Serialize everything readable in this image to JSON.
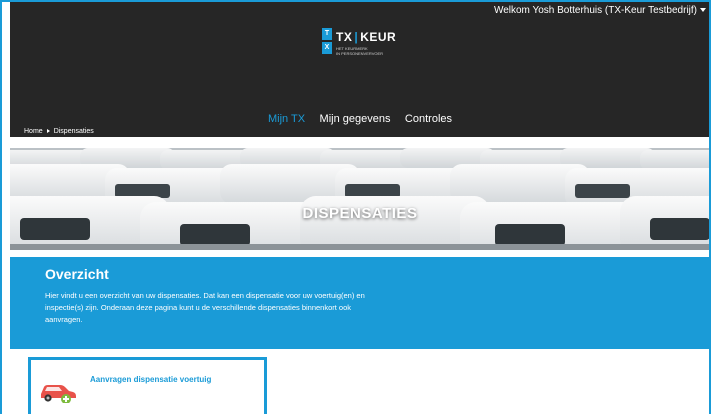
{
  "header": {
    "welcome": "Welkom Yosh Botterhuis (TX-Keur Testbedrijf)",
    "logo": {
      "mark_top": "T",
      "mark_bottom": "X",
      "word_left": "TX",
      "word_right": "KEUR",
      "tagline_1": "HET KEURMERK",
      "tagline_2": "IN PERSONENVERVOER"
    },
    "nav": [
      {
        "label": "Mijn TX",
        "active": true
      },
      {
        "label": "Mijn gegevens",
        "active": false
      },
      {
        "label": "Controles",
        "active": false
      }
    ]
  },
  "breadcrumb": {
    "home": "Home",
    "current": "Dispensaties"
  },
  "hero": {
    "title": "DISPENSATIES"
  },
  "overview": {
    "title": "Overzicht",
    "body": "Hier vindt u een overzicht van uw dispensaties. Dat kan een dispensatie voor uw voertuig(en) en inspectie(s) zijn. Onderaan deze pagina kunt u de verschillende dispensaties binnenkort ook aanvragen."
  },
  "cards": [
    {
      "label": "Aanvragen dispensatie voertuig",
      "icon": "car-add-icon"
    }
  ],
  "colors": {
    "accent": "#1a9bd7",
    "header_bg": "#262626",
    "car_red": "#e8524a",
    "add_green": "#7dbb3d"
  }
}
